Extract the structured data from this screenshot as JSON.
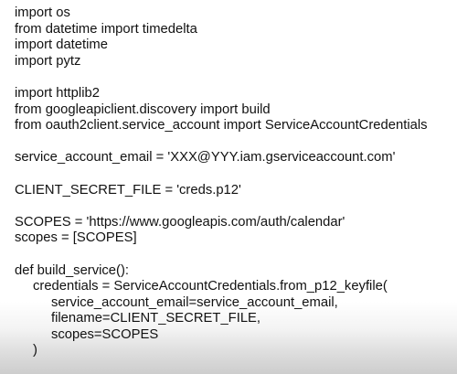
{
  "code": {
    "lines": [
      "import os",
      "from datetime import timedelta",
      "import datetime",
      "import pytz",
      "",
      "import httplib2",
      "from googleapiclient.discovery import build",
      "from oauth2client.service_account import ServiceAccountCredentials",
      "",
      "service_account_email = 'XXX@YYY.iam.gserviceaccount.com'",
      "",
      "CLIENT_SECRET_FILE = 'creds.p12'",
      "",
      "SCOPES = 'https://www.googleapis.com/auth/calendar'",
      "scopes = [SCOPES]",
      "",
      "def build_service():",
      "credentials = ServiceAccountCredentials.from_p12_keyfile(",
      "service_account_email=service_account_email,",
      "filename=CLIENT_SECRET_FILE,",
      "scopes=SCOPES",
      ")"
    ]
  }
}
